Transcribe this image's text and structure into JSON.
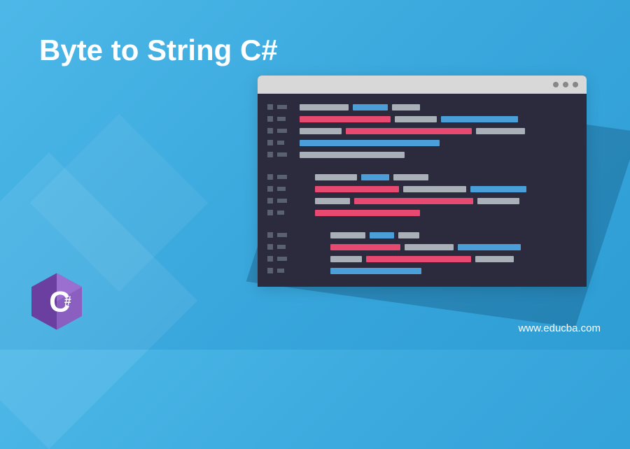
{
  "title": "Byte to String C#",
  "website": "www.educba.com",
  "logo": {
    "label": "C#",
    "primary_color": "#6b3fa0",
    "secondary_color": "#8a5fc0"
  },
  "editor": {
    "titlebar_dots": 3,
    "colors": {
      "gray": "#aab0b8",
      "blue": "#4a9fd8",
      "pink": "#e84971",
      "bg": "#2b2b3d"
    }
  }
}
